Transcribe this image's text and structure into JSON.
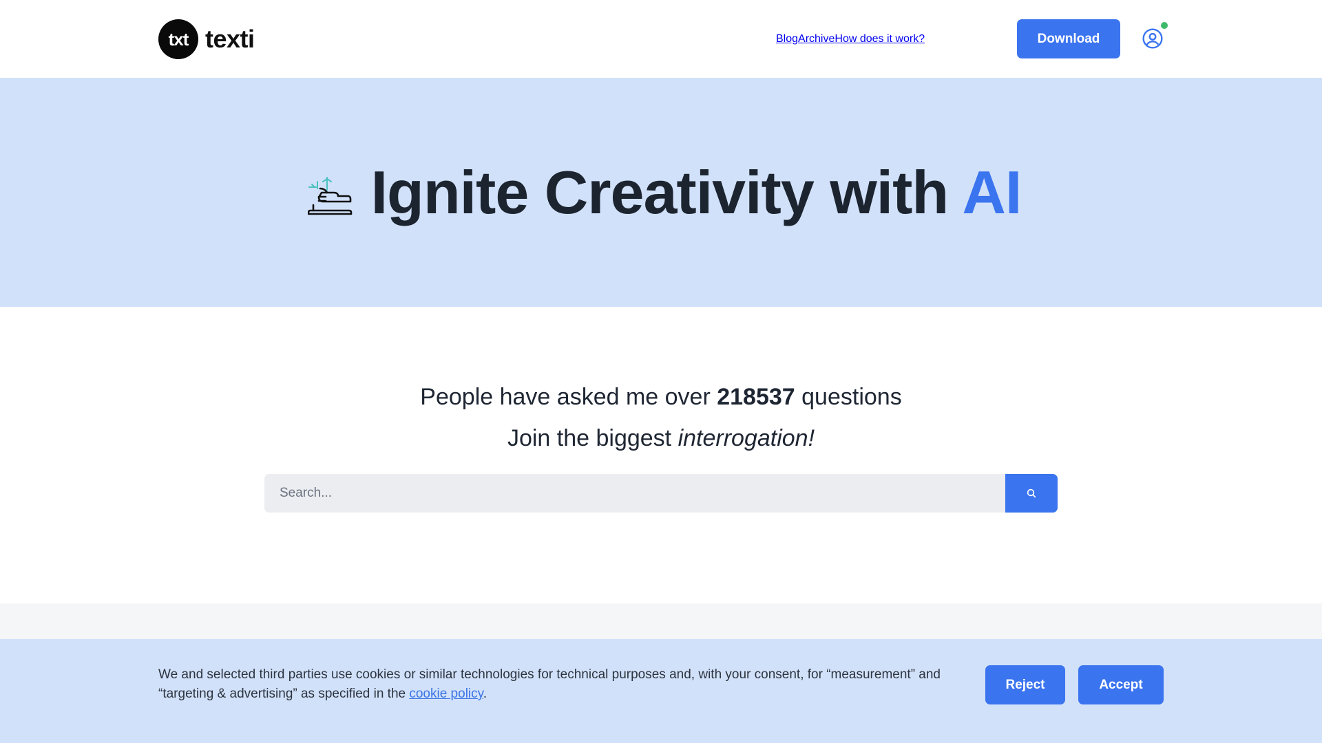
{
  "header": {
    "logo_badge": "txt",
    "logo_text": "texti",
    "nav": [
      {
        "label": "Blog"
      },
      {
        "label": "Archive"
      },
      {
        "label": "How does it work?"
      }
    ],
    "download_label": "Download",
    "user_status_color": "#3fb96b"
  },
  "hero": {
    "title_main": "Ignite Creativity with ",
    "title_accent": "AI",
    "icon": "hand-with-spark-icon"
  },
  "main": {
    "stats_prefix": "People have asked me over ",
    "stats_count": "218537",
    "stats_suffix": " questions",
    "tagline_prefix": "Join the biggest ",
    "tagline_emphasis": "interrogation!",
    "search": {
      "placeholder": "Search...",
      "value": ""
    }
  },
  "cookie": {
    "text_before_link": "We and selected third parties use cookies or similar technologies for technical purposes and, with your consent, for “measurement” and “targeting & advertising” as specified in the ",
    "link_label": "cookie policy",
    "text_after_link": ".",
    "reject_label": "Reject",
    "accept_label": "Accept"
  },
  "colors": {
    "accent": "#3b74ef",
    "hero_bg": "#d1e1f9",
    "text_dark": "#1c2430"
  }
}
